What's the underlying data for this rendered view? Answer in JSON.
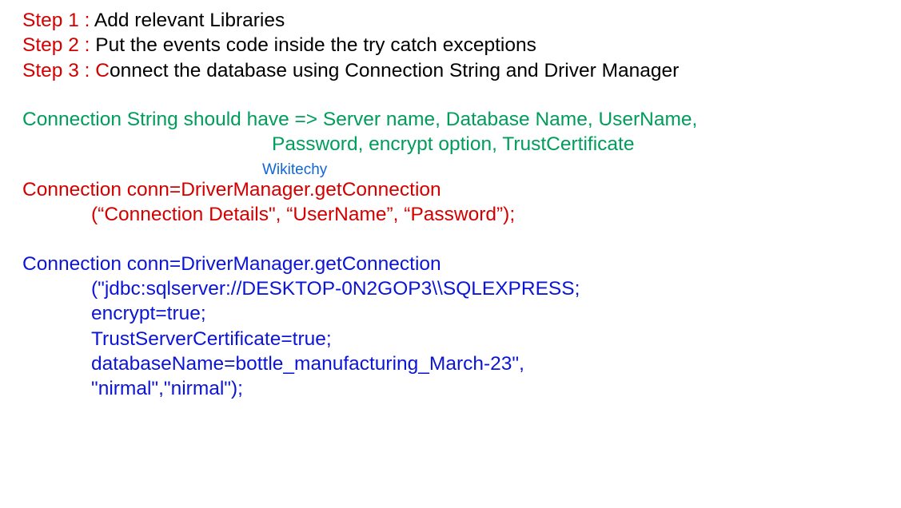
{
  "steps": {
    "s1_label": "Step 1 : ",
    "s1_text": "Add relevant Libraries",
    "s2_label": "Step 2 : ",
    "s2_text": "Put the events code inside the try catch exceptions",
    "s3_label": "Step 3 : ",
    "s3_c": "C",
    "s3_text": "onnect the database using Connection String and Driver Manager"
  },
  "conn_string_note": {
    "line1": "Connection String should have => Server name, Database Name, UserName,",
    "line2": "Password, encrypt option, TrustCertificate"
  },
  "watermark": "Wikitechy",
  "example1": {
    "line1": "Connection conn=DriverManager.getConnection",
    "line2": "(“Connection Details\", “UserName”, “Password”);"
  },
  "example2": {
    "line1": "Connection conn=DriverManager.getConnection",
    "line2": "(\"jdbc:sqlserver://DESKTOP-0N2GOP3\\\\SQLEXPRESS;",
    "line3": "encrypt=true;",
    "line4": "TrustServerCertificate=true;",
    "line5": "databaseName=bottle_manufacturing_March-23\",",
    "line6": "\"nirmal\",\"nirmal\");"
  }
}
